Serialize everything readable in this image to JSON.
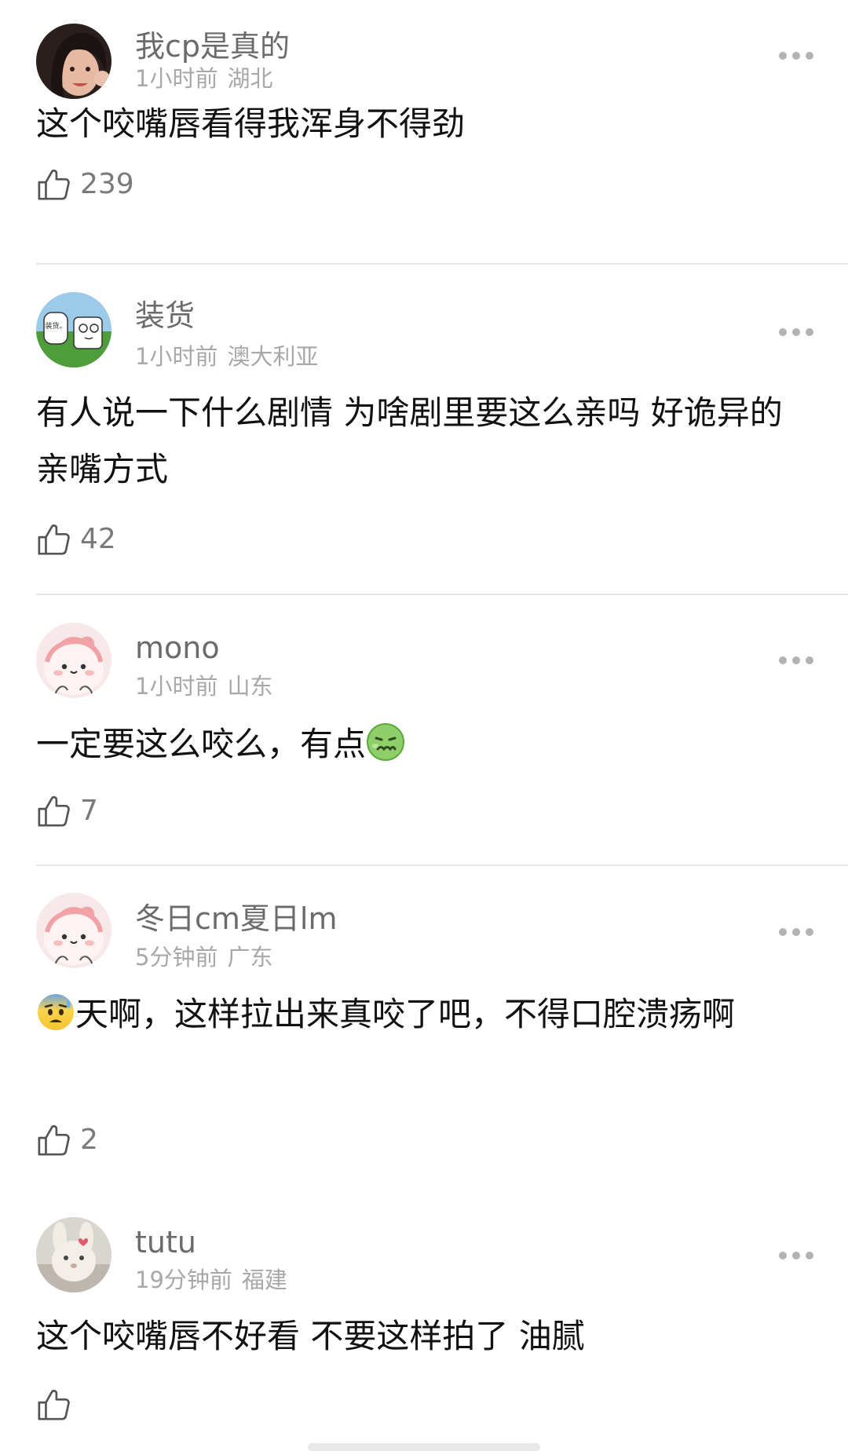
{
  "comments": [
    {
      "username": "我cp是真的",
      "time": "1小时前",
      "location": "湖北",
      "text": "这个咬嘴唇看得我浑身不得劲",
      "likes": "239",
      "avatar_icon": "avatar-photo-woman-icon"
    },
    {
      "username": "装货",
      "time": "1小时前",
      "location": "澳大利亚",
      "text": "有人说一下什么剧情 为啥剧里要这么亲吗 好诡异的亲嘴方式",
      "likes": "42",
      "avatar_icon": "avatar-cartoon-grass-icon",
      "avatar_bubble_text": "装货。"
    },
    {
      "username": "mono",
      "time": "1小时前",
      "location": "山东",
      "text": "一定要这么咬么，有点",
      "text_emoji": "nauseated-face-emoji",
      "likes": "7",
      "avatar_icon": "avatar-pink-bun-icon"
    },
    {
      "username": "冬日cm夏日lm",
      "time": "5分钟前",
      "location": "广东",
      "text_emoji": "anxious-sweat-face-emoji",
      "text": "天啊，这样拉出来真咬了吧，不得口腔溃疡啊",
      "likes": "2",
      "avatar_icon": "avatar-pink-bun-icon"
    },
    {
      "username": "tutu",
      "time": "19分钟前",
      "location": "福建",
      "text": "这个咬嘴唇不好看 不要这样拍了 油腻",
      "likes": "",
      "avatar_icon": "avatar-plush-bunny-icon"
    }
  ],
  "icons": {
    "like": "thumbs-up-icon",
    "more": "more-options-icon"
  },
  "colors": {
    "username": "#6b6b6b",
    "meta": "#a8a8a8",
    "text": "#111111",
    "count": "#7a7a7a",
    "divider": "#e6e6e6"
  }
}
